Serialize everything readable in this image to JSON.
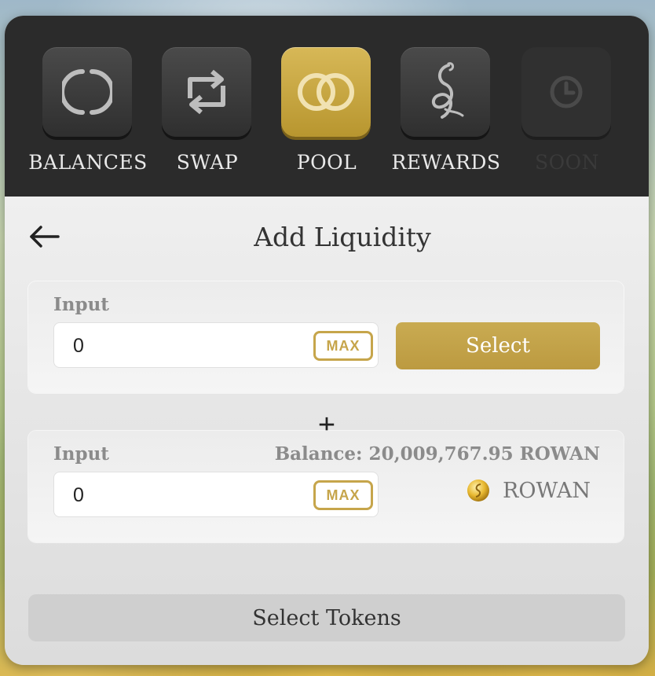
{
  "nav": {
    "items": [
      {
        "label": "BALANCES",
        "icon": "balances-icon"
      },
      {
        "label": "SWAP",
        "icon": "swap-icon"
      },
      {
        "label": "POOL",
        "icon": "pool-icon"
      },
      {
        "label": "REWARDS",
        "icon": "rewards-icon"
      },
      {
        "label": "SOON",
        "icon": "clock-icon"
      }
    ],
    "active": "POOL"
  },
  "header": {
    "title": "Add Liquidity"
  },
  "from": {
    "label": "Input",
    "value": "0",
    "max_label": "MAX",
    "select_label": "Select"
  },
  "plus": "+",
  "to": {
    "label": "Input",
    "balance": "Balance: 20,009,767.95 ROWAN",
    "value": "0",
    "max_label": "MAX",
    "token": "ROWAN",
    "token_icon": "rowan-coin-icon"
  },
  "action": {
    "label": "Select Tokens"
  },
  "colors": {
    "accent": "#c6a54b",
    "nav_bg": "#2b2b2b"
  }
}
